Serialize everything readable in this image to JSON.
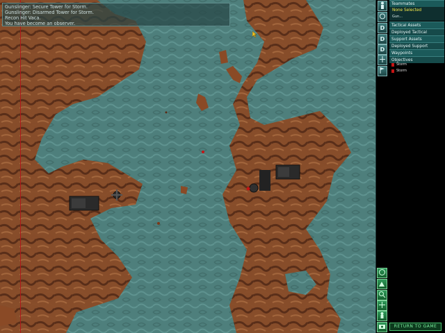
{
  "chat": {
    "lines": [
      "Gunslinger: Secure Tower for Storm.",
      "Gunslinger: Disarmed Tower for Storm.",
      "Recon Hit Vaca.",
      "You have become an observer."
    ]
  },
  "sidebar": {
    "teammates": "Teammates",
    "none_selected": "None Selected",
    "gunner": "Gun...",
    "tabs": {
      "tactical_assets": "Tactical Assets",
      "deployed_tactical": "Deployed Tactical",
      "support_assets": "Support Assets",
      "deployed_support": "Deployed Support",
      "waypoints": "Waypoints",
      "objectives": "Objectives"
    },
    "objectives": [
      "Storm",
      "Storm"
    ],
    "d_label": "D"
  },
  "bottom": {
    "abort": "RETURN TO GAME"
  },
  "colors": {
    "water": "#4e7f7c",
    "terrain": "#8a4a26",
    "panel": "#1b5a5a",
    "accent_green": "#47c06e",
    "objective_red": "#c41414"
  },
  "icons": {
    "zoom": "magnifier-icon",
    "camera": "camera-icon",
    "waypoint": "flag-icon"
  }
}
